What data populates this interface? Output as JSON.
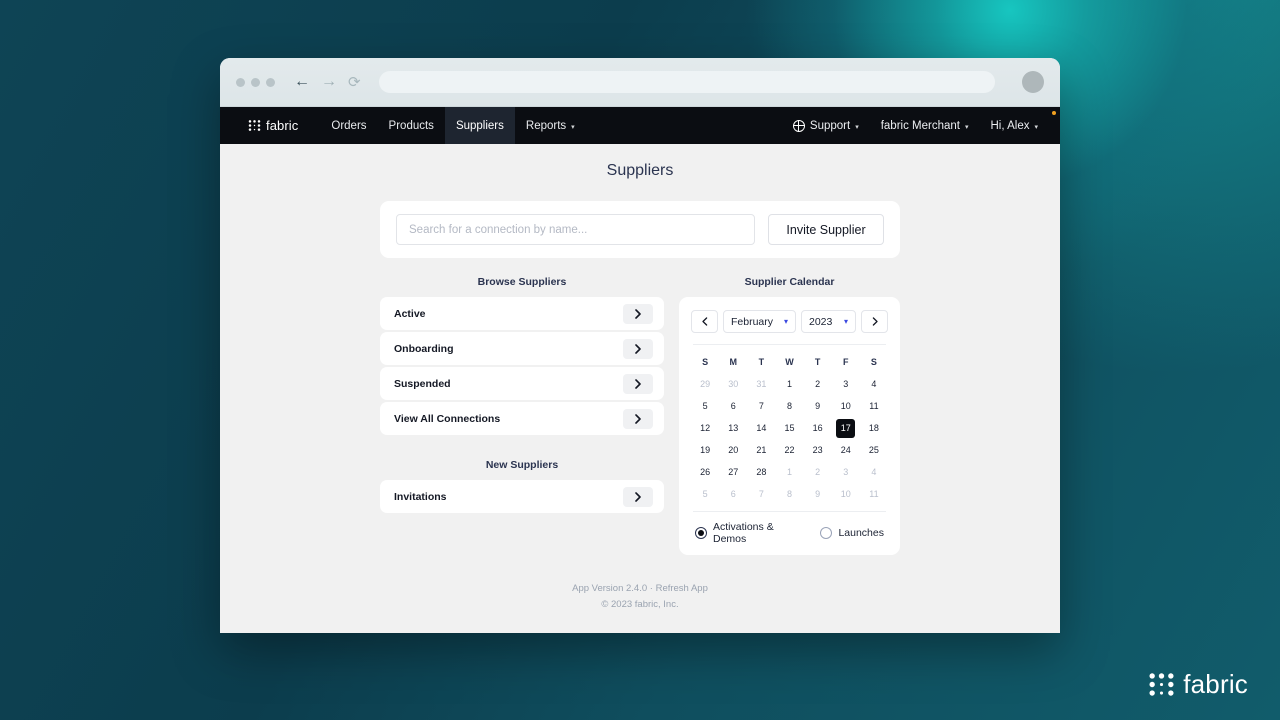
{
  "browser": {
    "back_icon": "arrow-left-icon",
    "forward_icon": "arrow-right-icon",
    "reload_icon": "reload-icon",
    "url_value": "",
    "avatar_icon": "profile-avatar-icon"
  },
  "nav": {
    "brand": "fabric",
    "items": [
      {
        "label": "Orders",
        "active": false,
        "caret": false
      },
      {
        "label": "Products",
        "active": false,
        "caret": false
      },
      {
        "label": "Suppliers",
        "active": true,
        "caret": false
      },
      {
        "label": "Reports",
        "active": false,
        "caret": true
      }
    ],
    "right": [
      {
        "label": "Support",
        "icon": "globe-icon",
        "caret": true
      },
      {
        "label": "fabric Merchant",
        "icon": null,
        "caret": true
      },
      {
        "label": "Hi, Alex",
        "icon": null,
        "caret": true
      }
    ],
    "caret_glyph": "▾",
    "notification_color": "#f0a020"
  },
  "page": {
    "title": "Suppliers"
  },
  "search": {
    "placeholder": "Search for a connection by name...",
    "value": "",
    "invite_label": "Invite Supplier"
  },
  "browse": {
    "heading": "Browse Suppliers",
    "items": [
      {
        "label": "Active"
      },
      {
        "label": "Onboarding"
      },
      {
        "label": "Suspended"
      },
      {
        "label": "View All Connections"
      }
    ]
  },
  "new_suppliers": {
    "heading": "New Suppliers",
    "items": [
      {
        "label": "Invitations"
      }
    ]
  },
  "calendar": {
    "heading": "Supplier Calendar",
    "prev_label": "‹",
    "next_label": "›",
    "month": "February",
    "year": "2023",
    "caret_glyph": "▾",
    "accent_color": "#3b4ae0",
    "dow": [
      "S",
      "M",
      "T",
      "W",
      "T",
      "F",
      "S"
    ],
    "selected_day": 17,
    "weeks": [
      [
        {
          "d": "29",
          "m": true
        },
        {
          "d": "30",
          "m": true
        },
        {
          "d": "31",
          "m": true
        },
        {
          "d": "1",
          "m": false
        },
        {
          "d": "2",
          "m": false
        },
        {
          "d": "3",
          "m": false
        },
        {
          "d": "4",
          "m": false
        }
      ],
      [
        {
          "d": "5",
          "m": false
        },
        {
          "d": "6",
          "m": false
        },
        {
          "d": "7",
          "m": false
        },
        {
          "d": "8",
          "m": false
        },
        {
          "d": "9",
          "m": false
        },
        {
          "d": "10",
          "m": false
        },
        {
          "d": "11",
          "m": false
        }
      ],
      [
        {
          "d": "12",
          "m": false
        },
        {
          "d": "13",
          "m": false
        },
        {
          "d": "14",
          "m": false
        },
        {
          "d": "15",
          "m": false
        },
        {
          "d": "16",
          "m": false
        },
        {
          "d": "17",
          "m": false,
          "sel": true
        },
        {
          "d": "18",
          "m": false
        }
      ],
      [
        {
          "d": "19",
          "m": false
        },
        {
          "d": "20",
          "m": false
        },
        {
          "d": "21",
          "m": false
        },
        {
          "d": "22",
          "m": false
        },
        {
          "d": "23",
          "m": false
        },
        {
          "d": "24",
          "m": false
        },
        {
          "d": "25",
          "m": false
        }
      ],
      [
        {
          "d": "26",
          "m": false
        },
        {
          "d": "27",
          "m": false
        },
        {
          "d": "28",
          "m": false
        },
        {
          "d": "1",
          "m": true
        },
        {
          "d": "2",
          "m": true
        },
        {
          "d": "3",
          "m": true
        },
        {
          "d": "4",
          "m": true
        }
      ],
      [
        {
          "d": "5",
          "m": true
        },
        {
          "d": "6",
          "m": true
        },
        {
          "d": "7",
          "m": true
        },
        {
          "d": "8",
          "m": true
        },
        {
          "d": "9",
          "m": true
        },
        {
          "d": "10",
          "m": true
        },
        {
          "d": "11",
          "m": true
        }
      ]
    ],
    "radios": [
      {
        "label": "Activations & Demos",
        "selected": true
      },
      {
        "label": "Launches",
        "selected": false
      }
    ]
  },
  "footer": {
    "version_text": "App Version 2.4.0 · ",
    "refresh_label": "Refresh App",
    "copyright": "© 2023 fabric, Inc."
  },
  "corner_logo": {
    "word": "fabric"
  }
}
